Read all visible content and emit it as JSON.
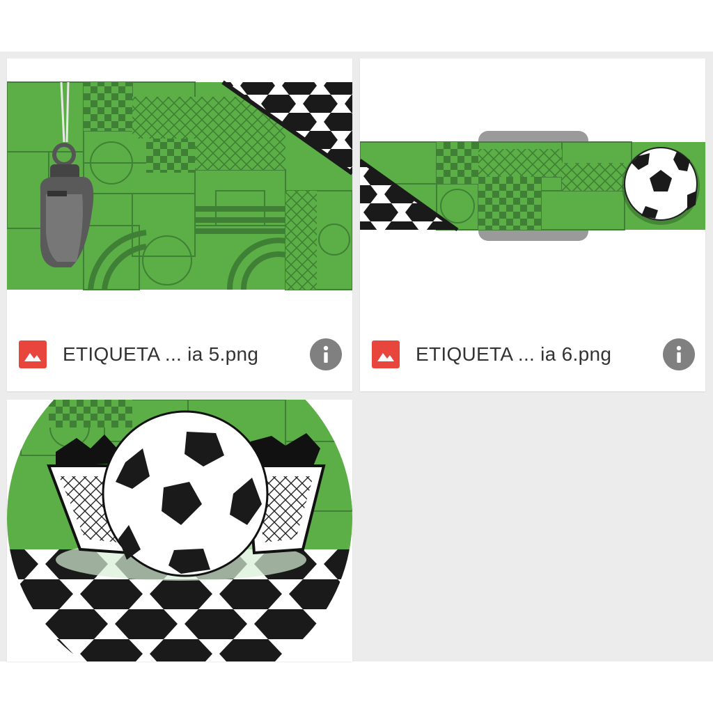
{
  "files": [
    {
      "name": "ETIQUETA ... ia 5.png",
      "icon": "image-file-icon",
      "info_icon": "info-icon"
    },
    {
      "name": "ETIQUETA ... ia 6.png",
      "icon": "image-file-icon",
      "info_icon": "info-icon"
    },
    {
      "name": "",
      "icon": "",
      "info_icon": ""
    }
  ],
  "colors": {
    "field_green": "#5cae46",
    "line_green": "#3f8036",
    "file_icon_red": "#e8463c",
    "info_gray": "#808080",
    "background": "#ececec"
  }
}
